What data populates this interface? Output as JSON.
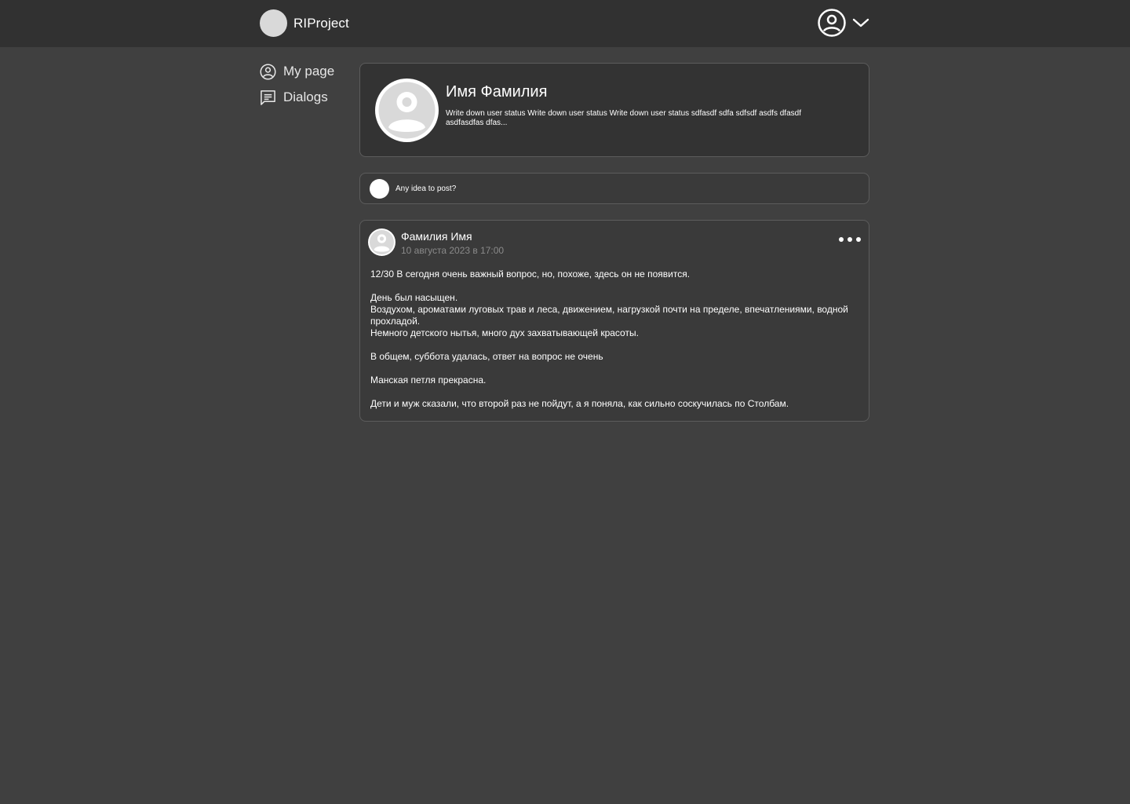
{
  "app": {
    "name": "RIProject"
  },
  "header": {
    "account_icon": "user-circle-icon",
    "dropdown_icon": "chevron-down-icon"
  },
  "sidebar": {
    "items": [
      {
        "label": "My page",
        "icon": "user-circle-icon"
      },
      {
        "label": "Dialogs",
        "icon": "message-icon"
      }
    ]
  },
  "profile": {
    "name": "Имя Фамилия",
    "status": "Write down user status Write down user status Write down user status sdfasdf sdfa sdfsdf asdfs dfasdf asdfasdfas dfas..."
  },
  "composer": {
    "placeholder": "Any idea to post?"
  },
  "post": {
    "author": "Фамилия Имя",
    "date": "10 августа 2023 в 17:00",
    "menu_icon": "more-dots-icon",
    "paragraphs": [
      [
        "12/30 В сегодня очень важный вопрос, но, похоже, здесь он не появится."
      ],
      [
        "День был насыщен.",
        "Воздухом, ароматами луговых трав и леса, движением, нагрузкой почти на пределе, впечатлениями, водной прохладой.",
        "Немного детского нытья, много дух захватывающей красоты."
      ],
      [
        "В общем, суббота удалась, ответ на вопрос не очень"
      ],
      [
        "Манская петля прекрасна."
      ],
      [
        "Дети и муж сказали, что второй раз не пойдут, а я поняла, как сильно соскучилась по Столбам."
      ]
    ]
  },
  "colors": {
    "background": "#404040",
    "topbar": "#313131",
    "card": "#353535",
    "border": "#5c5c5c",
    "muted_text": "#8a8a8a"
  }
}
